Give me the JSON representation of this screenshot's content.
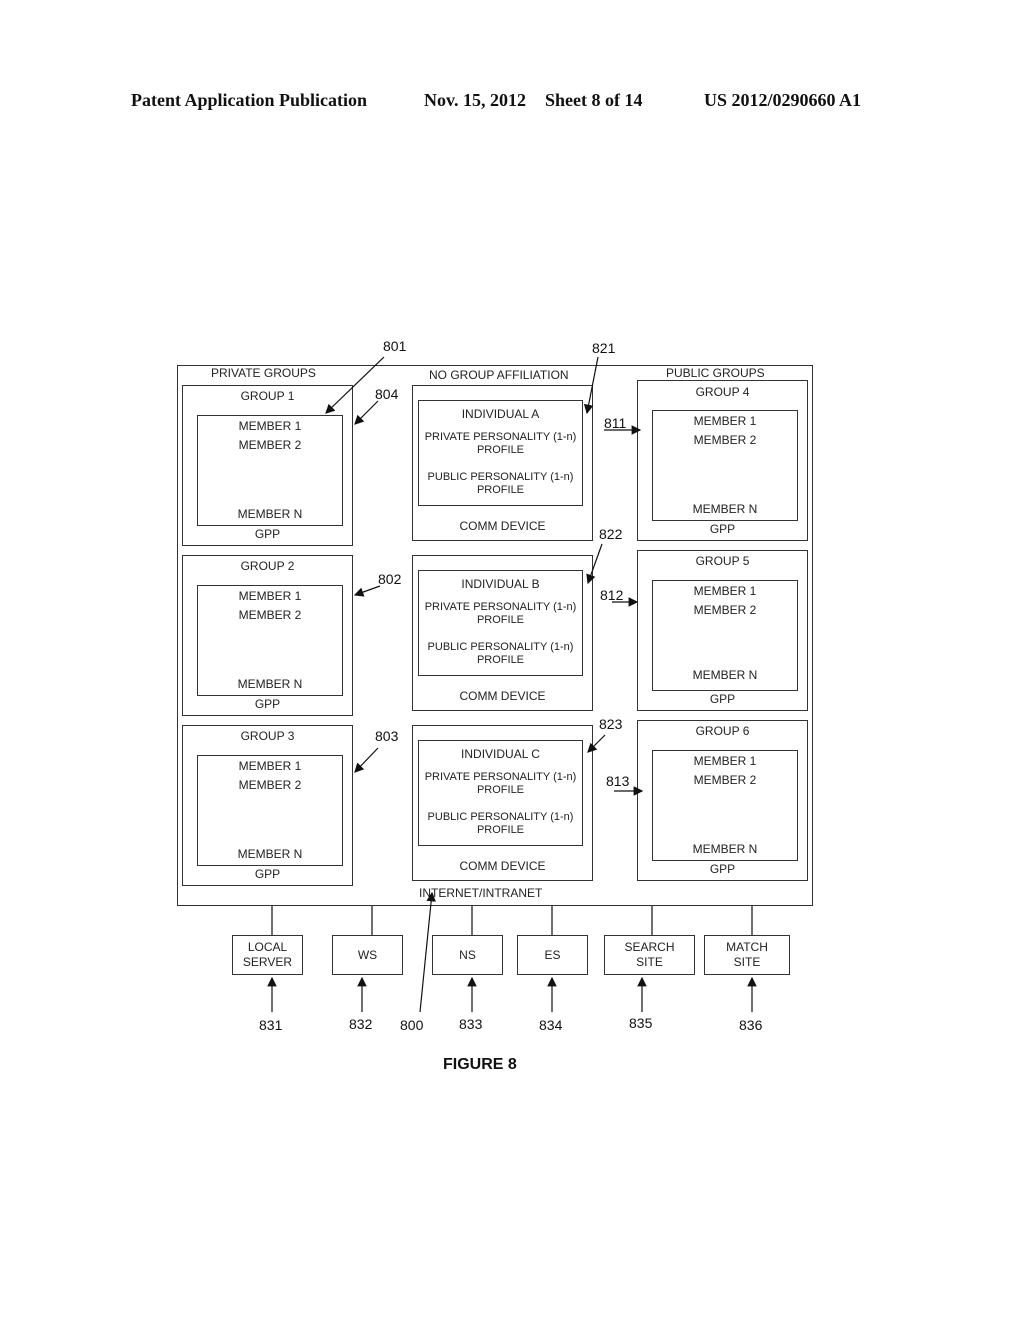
{
  "header": {
    "left": "Patent Application Publication",
    "date": "Nov. 15, 2012",
    "sheet": "Sheet 8 of 14",
    "number": "US 2012/0290660 A1"
  },
  "figure_label": "FIGURE 8",
  "network_label": "INTERNET/INTRANET",
  "columns": {
    "private": "PRIVATE GROUPS",
    "none": "NO GROUP AFFILIATION",
    "public": "PUBLIC GROUPS"
  },
  "private_groups": [
    {
      "title": "GROUP 1",
      "members": [
        "MEMBER 1",
        "MEMBER 2",
        "MEMBER N"
      ],
      "footer": "GPP",
      "ref": "804"
    },
    {
      "title": "GROUP 2",
      "members": [
        "MEMBER 1",
        "MEMBER 2",
        "MEMBER N"
      ],
      "footer": "GPP",
      "ref": "802"
    },
    {
      "title": "GROUP 3",
      "members": [
        "MEMBER 1",
        "MEMBER 2",
        "MEMBER N"
      ],
      "footer": "GPP",
      "ref": "803"
    }
  ],
  "individuals": [
    {
      "title": "INDIVIDUAL A",
      "private": "PRIVATE PERSONALITY (1-n)",
      "private2": "PROFILE",
      "public": "PUBLIC PERSONALITY (1-n)",
      "public2": "PROFILE",
      "footer": "COMM DEVICE",
      "ref": "821"
    },
    {
      "title": "INDIVIDUAL B",
      "private": "PRIVATE PERSONALITY (1-n)",
      "private2": "PROFILE",
      "public": "PUBLIC PERSONALITY (1-n)",
      "public2": "PROFILE",
      "footer": "COMM DEVICE",
      "ref": "822"
    },
    {
      "title": "INDIVIDUAL C",
      "private": "PRIVATE PERSONALITY (1-n)",
      "private2": "PROFILE",
      "public": "PUBLIC PERSONALITY (1-n)",
      "public2": "PROFILE",
      "footer": "COMM DEVICE",
      "ref": "823"
    }
  ],
  "public_groups": [
    {
      "title": "GROUP 4",
      "members": [
        "MEMBER 1",
        "MEMBER 2",
        "MEMBER N"
      ],
      "footer": "GPP",
      "ref": "811"
    },
    {
      "title": "GROUP 5",
      "members": [
        "MEMBER 1",
        "MEMBER 2",
        "MEMBER N"
      ],
      "footer": "GPP",
      "ref": "812"
    },
    {
      "title": "GROUP 6",
      "members": [
        "MEMBER 1",
        "MEMBER 2",
        "MEMBER N"
      ],
      "footer": "GPP",
      "ref": "813"
    }
  ],
  "refs": {
    "member_box": "801",
    "network": "800"
  },
  "servers": [
    {
      "line1": "LOCAL",
      "line2": "SERVER",
      "ref": "831"
    },
    {
      "line1": "WS",
      "line2": "",
      "ref": "832"
    },
    {
      "line1": "NS",
      "line2": "",
      "ref": "833"
    },
    {
      "line1": "ES",
      "line2": "",
      "ref": "834"
    },
    {
      "line1": "SEARCH",
      "line2": "SITE",
      "ref": "835"
    },
    {
      "line1": "MATCH",
      "line2": "SITE",
      "ref": "836"
    }
  ]
}
